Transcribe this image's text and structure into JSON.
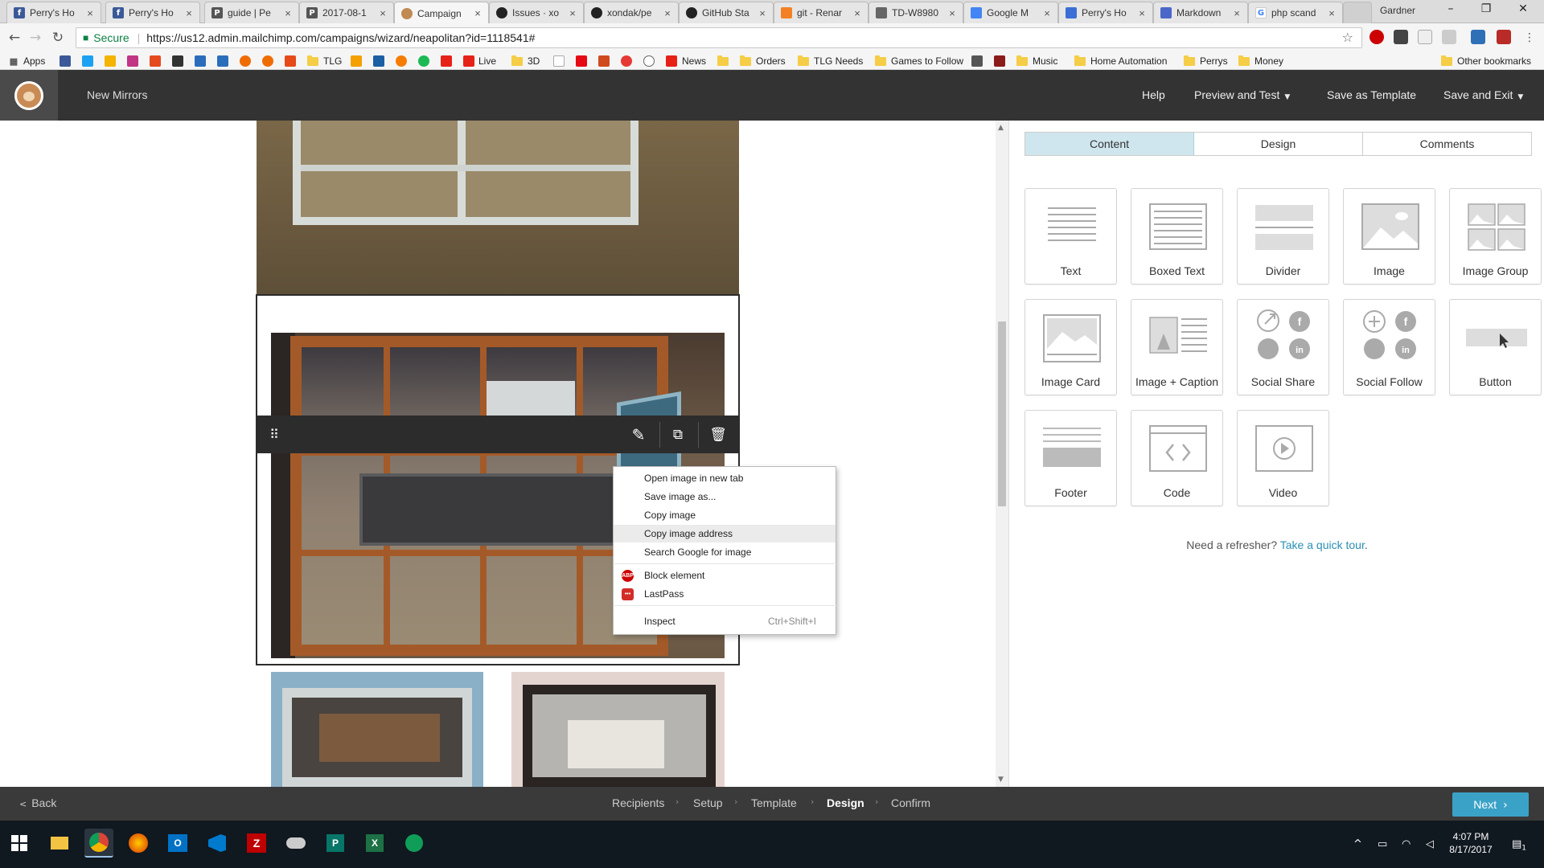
{
  "browser": {
    "tabs": [
      {
        "title": "Perry's Ho",
        "favicon": "facebook-icon",
        "color": "#3b5998"
      },
      {
        "title": "Perry's Ho",
        "favicon": "facebook-icon",
        "color": "#3b5998"
      },
      {
        "title": "guide | Pe",
        "favicon": "p-letter-icon",
        "color": "#555555"
      },
      {
        "title": "2017-08-1",
        "favicon": "p-letter-icon",
        "color": "#555555"
      },
      {
        "title": "Campaign",
        "favicon": "mailchimp-icon",
        "color": "#c08a52"
      },
      {
        "title": "Issues · xo",
        "favicon": "github-icon",
        "color": "#222222"
      },
      {
        "title": "xondak/pe",
        "favicon": "github-icon",
        "color": "#222222"
      },
      {
        "title": "GitHub Sta",
        "favicon": "github-icon",
        "color": "#222222"
      },
      {
        "title": "git - Renar",
        "favicon": "stackoverflow-icon",
        "color": "#f48024"
      },
      {
        "title": "TD-W8980",
        "favicon": "router-icon",
        "color": "#666666"
      },
      {
        "title": "Google M",
        "favicon": "google-doc-icon",
        "color": "#4285f4"
      },
      {
        "title": "Perry's Ho",
        "favicon": "doc-icon",
        "color": "#3b6fd6"
      },
      {
        "title": "Markdown",
        "favicon": "markdown-icon",
        "color": "#4a67c9"
      },
      {
        "title": "php scand",
        "favicon": "google-icon",
        "color": "#4285f4"
      }
    ],
    "profile_name": "Gardner",
    "address": {
      "secure_label": "Secure",
      "url": "https://us12.admin.mailchimp.com/campaigns/wizard/neapolitan?id=1118541#"
    },
    "bookmarks": {
      "apps_label": "Apps",
      "items": [
        "TLG",
        "Live",
        "3D",
        "News",
        "Orders",
        "TLG Needs",
        "Games to Follow",
        "Music",
        "Home Automation",
        "Perrys",
        "Money"
      ],
      "other_label": "Other bookmarks"
    }
  },
  "header": {
    "campaign_name": "New Mirrors",
    "nav": {
      "help": "Help",
      "preview": "Preview and Test",
      "save_template": "Save as Template",
      "save_exit": "Save and Exit"
    }
  },
  "context_menu": {
    "items": [
      {
        "label": "Open image in new tab"
      },
      {
        "label": "Save image as..."
      },
      {
        "label": "Copy image"
      },
      {
        "label": "Copy image address",
        "highlighted": true
      },
      {
        "label": "Search Google for image"
      }
    ],
    "extensions": [
      {
        "label": "Block element",
        "icon": "adblock-icon"
      },
      {
        "label": "LastPass",
        "icon": "lastpass-icon"
      }
    ],
    "inspect": {
      "label": "Inspect",
      "shortcut": "Ctrl+Shift+I"
    }
  },
  "panel": {
    "tabs": [
      "Content",
      "Design",
      "Comments"
    ],
    "active_tab": "Content",
    "blocks": [
      "Text",
      "Boxed Text",
      "Divider",
      "Image",
      "Image Group",
      "Image Card",
      "Image + Caption",
      "Social Share",
      "Social Follow",
      "Button",
      "Footer",
      "Code",
      "Video"
    ],
    "refresher_text": "Need a refresher?",
    "refresher_link": "Take a quick tour",
    "refresher_end": "."
  },
  "wizard": {
    "back": "Back",
    "steps": [
      "Recipients",
      "Setup",
      "Template",
      "Design",
      "Confirm"
    ],
    "current_step": "Design",
    "next": "Next"
  },
  "taskbar": {
    "time": "4:07 PM",
    "date": "8/17/2017",
    "notification_count": "1"
  },
  "colors": {
    "accent": "#3ba2c7",
    "header_bg": "#333333",
    "active_tab_bg": "#cfe6ee"
  }
}
